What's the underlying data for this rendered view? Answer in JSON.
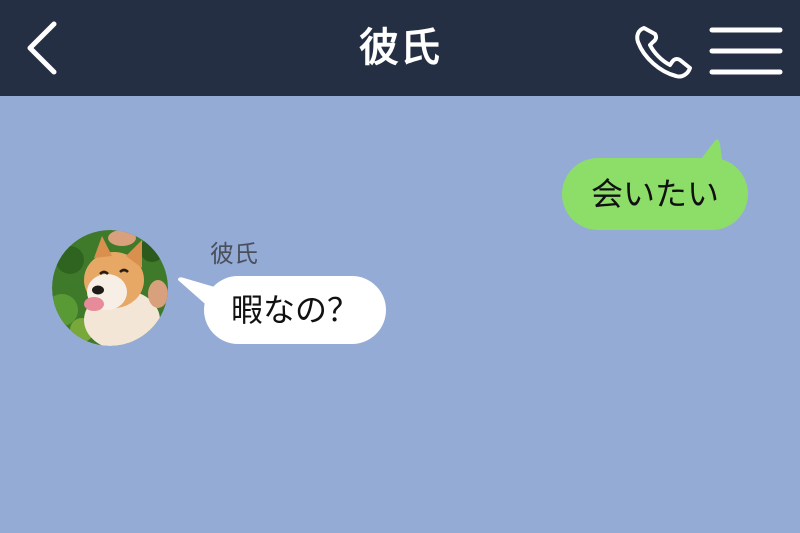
{
  "header": {
    "title": "彼氏",
    "icons": [
      "back-icon",
      "phone-icon",
      "menu-icon"
    ],
    "background": "#252f44"
  },
  "chat": {
    "background": "#94abd6",
    "messages": [
      {
        "direction": "outgoing",
        "text": "会いたい",
        "bubble_color": "#8dde68"
      },
      {
        "direction": "incoming",
        "sender": "彼氏",
        "text": "暇なの？",
        "bubble_color": "#ffffff",
        "avatar": "dog-avatar-icon"
      }
    ]
  }
}
